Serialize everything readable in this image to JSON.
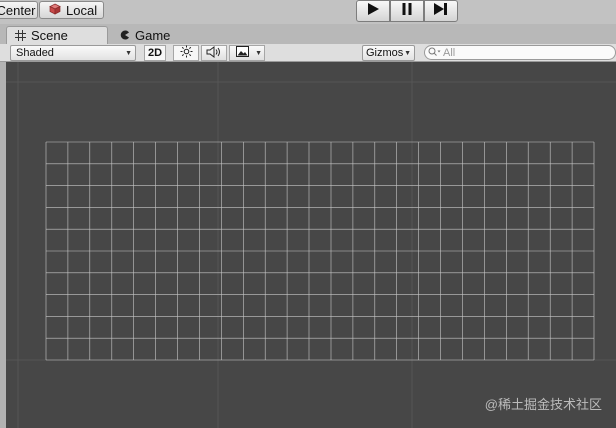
{
  "toolbar": {
    "center_label": "Center",
    "local_label": "Local",
    "play_icon": "play-icon",
    "pause_icon": "pause-icon",
    "step_icon": "step-icon"
  },
  "tabs": [
    {
      "label": "Scene",
      "icon": "grid-hash-icon",
      "active": true
    },
    {
      "label": "Game",
      "icon": "pacman-icon",
      "active": false
    }
  ],
  "scene_toolbar": {
    "shading_mode": "Shaded",
    "mode_2d": "2D",
    "gizmos_label": "Gizmos",
    "search_placeholder": "All",
    "search_value": ""
  },
  "viewport": {
    "watermark": "@稀土掘金技术社区",
    "grid_columns": 25,
    "grid_rows": 10
  },
  "colors": {
    "viewport_bg": "#474747",
    "grid_line": "#c8c8c8",
    "chrome": "#c2c2c2"
  }
}
